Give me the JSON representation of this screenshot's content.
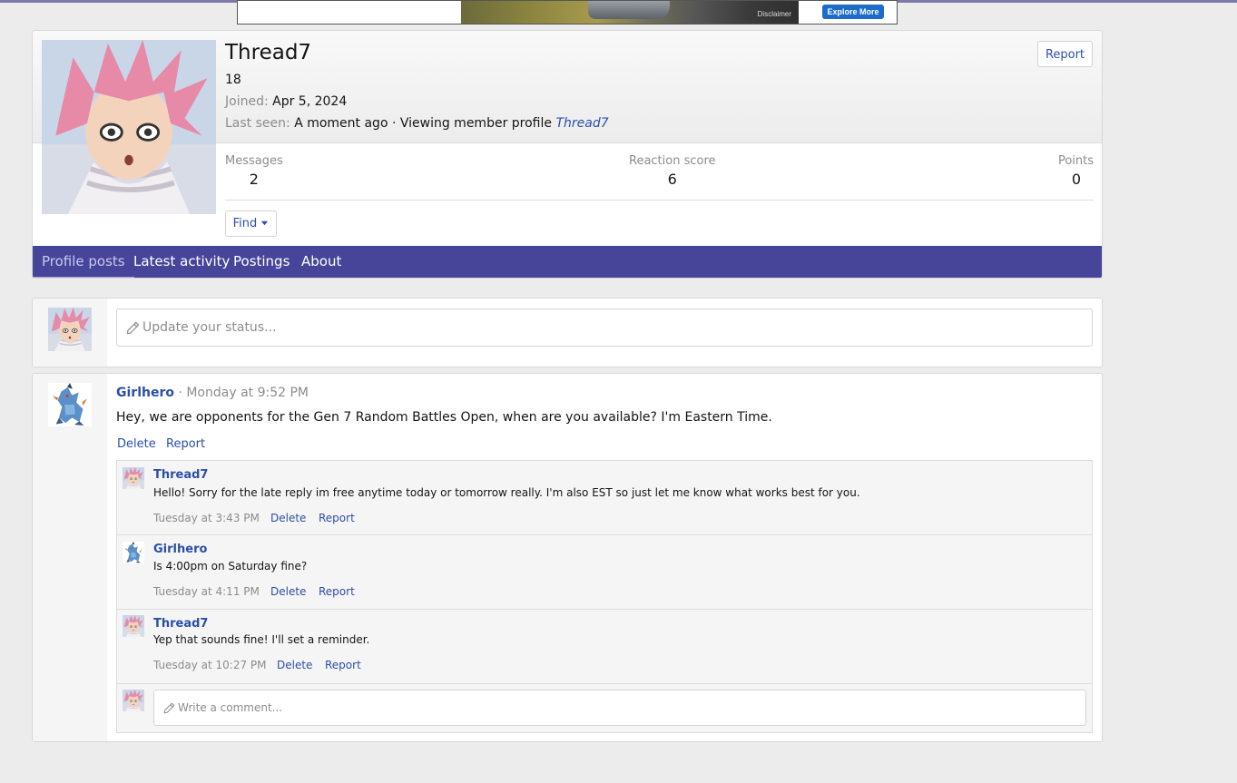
{
  "ad": {
    "disclaimer": "Disclaimer",
    "cta_label": "Explore More"
  },
  "profile": {
    "username": "Thread7",
    "custom_title": "18",
    "joined_label": "Joined:",
    "joined_value": "Apr 5, 2024",
    "last_seen_label": "Last seen:",
    "last_seen_value": "A moment ago · Viewing member profile",
    "last_seen_link": "Thread7",
    "report_label": "Report",
    "stats": [
      {
        "label": "Messages",
        "value": "2"
      },
      {
        "label": "Reaction score",
        "value": "6"
      },
      {
        "label": "Points",
        "value": "0"
      }
    ],
    "find_label": "Find",
    "tabs": [
      "Profile posts",
      "Latest activity",
      "Postings",
      "About"
    ]
  },
  "status": {
    "placeholder": "Update your status..."
  },
  "post": {
    "author": "Girlhero",
    "time": "Monday at 9:52 PM",
    "body": "Hey, we are opponents for the Gen 7 Random Battles Open, when are you available? I'm Eastern Time.",
    "delete_label": "Delete",
    "report_label": "Report",
    "comments": [
      {
        "author": "Thread7",
        "text": "Hello! Sorry for the late reply im free anytime today or tomorrow really. I'm also EST so just let me know what works best for you.",
        "time": "Tuesday at 3:43 PM",
        "delete_label": "Delete",
        "report_label": "Report"
      },
      {
        "author": "Girlhero",
        "text": "Is 4:00pm on Saturday fine?",
        "time": "Tuesday at 4:11 PM",
        "delete_label": "Delete",
        "report_label": "Report"
      },
      {
        "author": "Thread7",
        "text": "Yep that sounds fine! I'll set a reminder.",
        "time": "Tuesday at 10:27 PM",
        "delete_label": "Delete",
        "report_label": "Report"
      }
    ],
    "comment_placeholder": "Write a comment..."
  },
  "colors": {
    "accent": "#46459a",
    "link": "#2b4fa8"
  }
}
